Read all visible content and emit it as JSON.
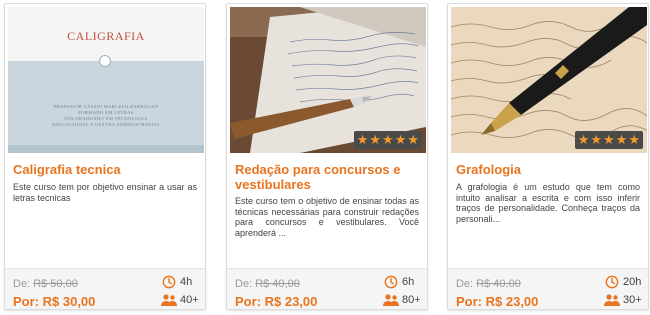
{
  "colors": {
    "accent": "#e8741f",
    "star": "#f39a2b",
    "star_bg": "#4a4a4a",
    "slide_title": "#c0503a"
  },
  "courses": [
    {
      "title": "Caligrafia tecnica",
      "description": "Este curso tem por objetivo ensinar a usar as letras tecnicas",
      "price_old_label": "De:",
      "price_old": "R$ 50,00",
      "price_new_label": "Por:",
      "price_new": "R$ 30,00",
      "duration": "4h",
      "students": "40+",
      "rating": 0,
      "image": {
        "title": "CALIGRAFIA",
        "lines": [
          "PROFESSOR CÁSSIO MARCELO BARRAGAN",
          "FORMADO EM LETRAS",
          "PÓS GRADUADO EM TECNOLOGIA",
          "EDUCACIONAL E GESTÃO ADMINISTRATIVA"
        ]
      }
    },
    {
      "title": "Redação para concursos e vestibulares",
      "description": "Este curso tem o objetivo de ensinar todas as técnicas necessárias para construir redações para concursos e vestibulares. Você aprenderá ...",
      "price_old_label": "De:",
      "price_old": "R$ 40,00",
      "price_new_label": "Por:",
      "price_new": "R$ 23,00",
      "duration": "6h",
      "students": "80+",
      "rating": 5
    },
    {
      "title": "Grafologia",
      "description": "A grafologia é um estudo que tem como intuito analisar a escrita e com isso inferir traços de personalidade.  Conheça traços da personali...",
      "price_old_label": "De:",
      "price_old": "R$ 40,00",
      "price_new_label": "Por:",
      "price_new": "R$ 23,00",
      "duration": "20h",
      "students": "30+",
      "rating": 5
    }
  ],
  "icons": {
    "duration": "clock-icon",
    "students": "people-icon",
    "rating": "star-icon"
  }
}
